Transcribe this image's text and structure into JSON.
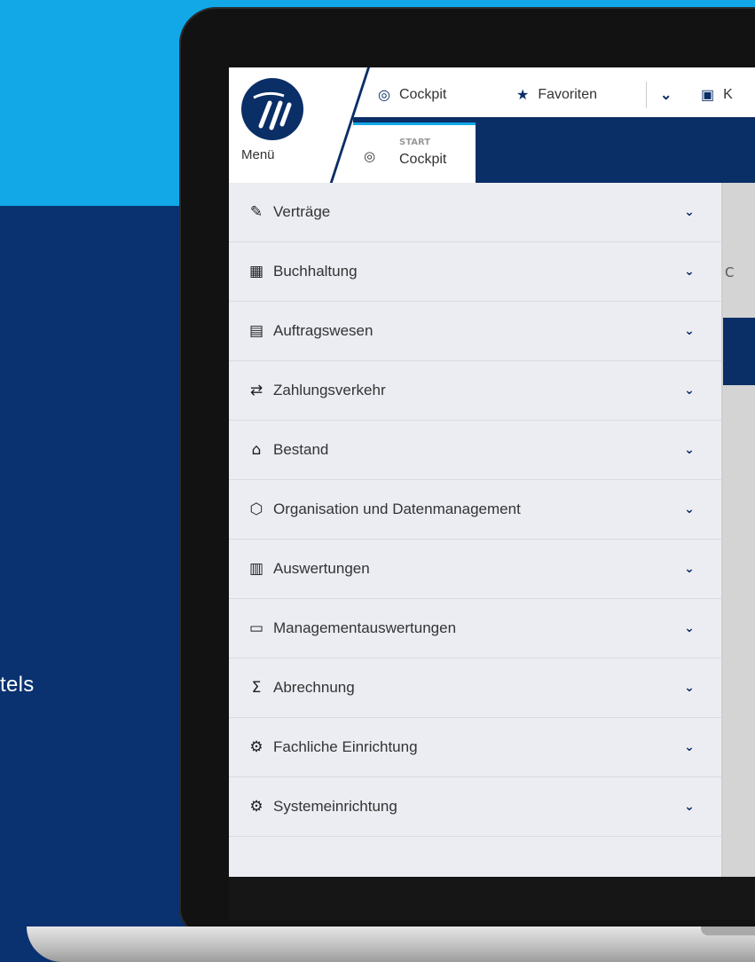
{
  "background_text": "tels",
  "topbar": {
    "menu_label": "Menü",
    "cockpit_label": "Cockpit",
    "favoriten_label": "Favoriten",
    "truncated_label": "K"
  },
  "tab": {
    "small_label": "START",
    "title": "Cockpit"
  },
  "content": {
    "partial_text": "C"
  },
  "menu": {
    "items": [
      {
        "label": "Verträge",
        "icon": "edit-icon",
        "glyph": "✎"
      },
      {
        "label": "Buchhaltung",
        "icon": "calculator-icon",
        "glyph": "▦"
      },
      {
        "label": "Auftragswesen",
        "icon": "clipboard-icon",
        "glyph": "▤"
      },
      {
        "label": "Zahlungsverkehr",
        "icon": "money-transfer-icon",
        "glyph": "⇄"
      },
      {
        "label": "Bestand",
        "icon": "houses-icon",
        "glyph": "⌂"
      },
      {
        "label": "Organisation und Datenmanagement",
        "icon": "cube-icon",
        "glyph": "⬡"
      },
      {
        "label": "Auswertungen",
        "icon": "bar-chart-icon",
        "glyph": "▥"
      },
      {
        "label": "Managementauswertungen",
        "icon": "presentation-icon",
        "glyph": "▭"
      },
      {
        "label": "Abrechnung",
        "icon": "sum-document-icon",
        "glyph": "Σ"
      },
      {
        "label": "Fachliche Einrichtung",
        "icon": "gear-document-icon",
        "glyph": "⚙"
      },
      {
        "label": "Systemeinrichtung",
        "icon": "gear-window-icon",
        "glyph": "⚙"
      }
    ]
  },
  "colors": {
    "navy": "#0a2e66",
    "sky": "#12a8e8",
    "menu_bg": "#ebedf3"
  }
}
